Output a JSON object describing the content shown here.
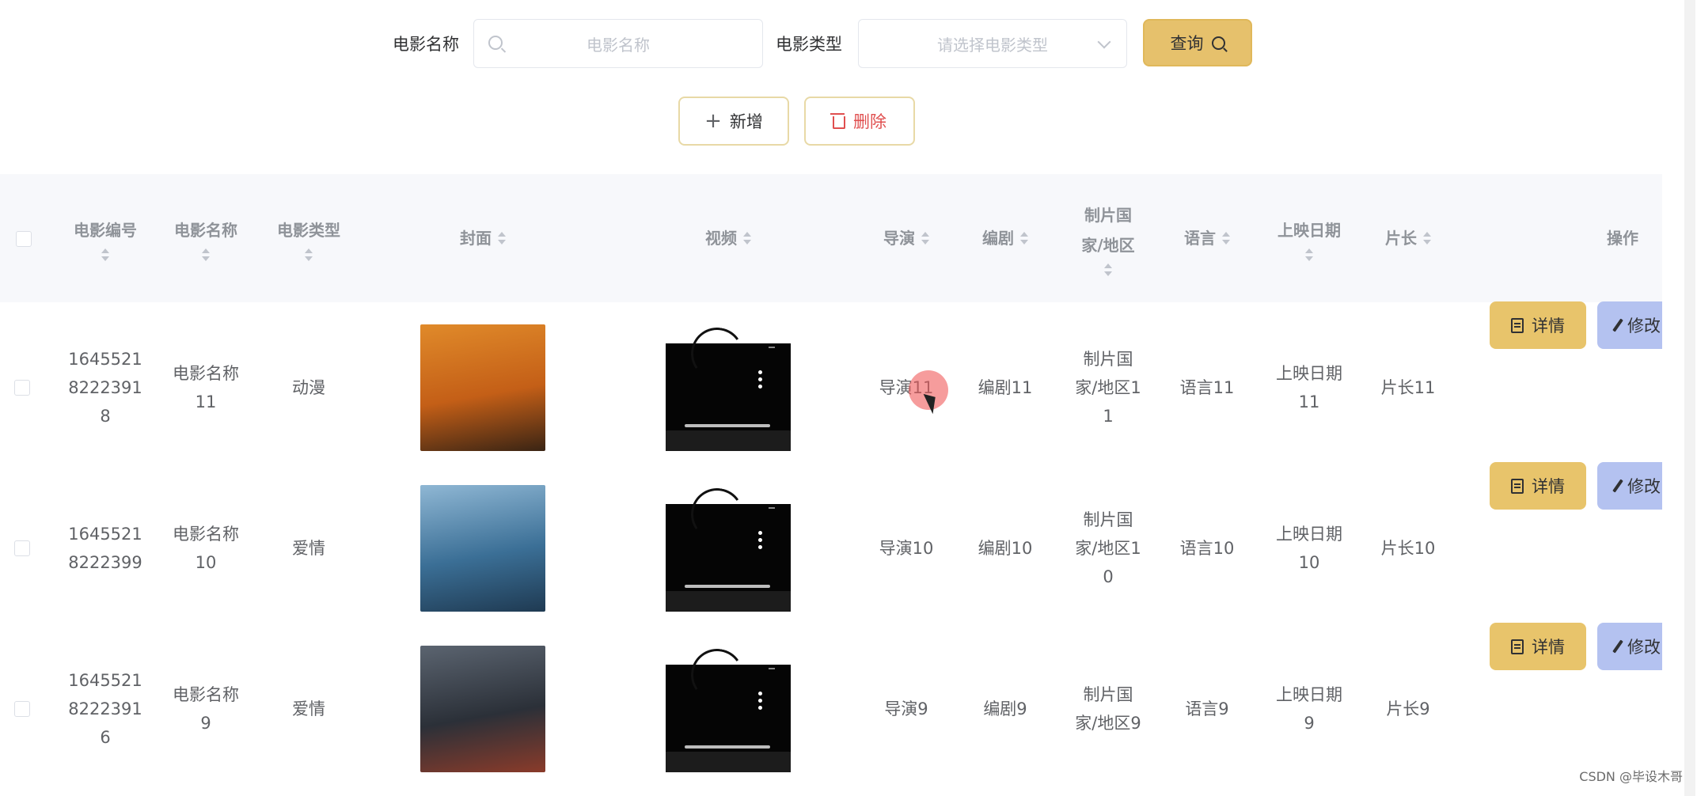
{
  "search": {
    "name_label": "电影名称",
    "name_placeholder": "电影名称",
    "type_label": "电影类型",
    "type_placeholder": "请选择电影类型",
    "query_label": "查询"
  },
  "actions": {
    "add_label": "新增",
    "delete_label": "删除"
  },
  "table": {
    "headers": {
      "id": "电影编号",
      "name": "电影名称",
      "type": "电影类型",
      "cover": "封面",
      "video": "视频",
      "director": "导演",
      "writer": "编剧",
      "country_line1": "制片国",
      "country_line2": "家/地区",
      "language": "语言",
      "release": "上映日期",
      "duration": "片长",
      "ops": "操作"
    },
    "rows": [
      {
        "id_lines": [
          "1645521",
          "8222391",
          "8"
        ],
        "name_lines": [
          "电影名称",
          "11"
        ],
        "type": "动漫",
        "director": "导演11",
        "writer": "编剧11",
        "country_lines": [
          "制片国",
          "家/地区1",
          "1"
        ],
        "language": "语言11",
        "release_lines": [
          "上映日期",
          "11"
        ],
        "duration": "片长11",
        "cover_colors": [
          "#e08a2a",
          "#c45f17",
          "#3a2414"
        ],
        "detail_label": "详情",
        "edit_label": "修改"
      },
      {
        "id_lines": [
          "1645521",
          "8222399"
        ],
        "name_lines": [
          "电影名称",
          "10"
        ],
        "type": "爱情",
        "director": "导演10",
        "writer": "编剧10",
        "country_lines": [
          "制片国",
          "家/地区1",
          "0"
        ],
        "language": "语言10",
        "release_lines": [
          "上映日期",
          "10"
        ],
        "duration": "片长10",
        "cover_colors": [
          "#8fb7d4",
          "#3b6f96",
          "#1f3a52"
        ],
        "detail_label": "详情",
        "edit_label": "修改"
      },
      {
        "id_lines": [
          "1645521",
          "8222391",
          "6"
        ],
        "name_lines": [
          "电影名称",
          "9"
        ],
        "type": "爱情",
        "director": "导演9",
        "writer": "编剧9",
        "country_lines": [
          "制片国",
          "家/地区9"
        ],
        "language": "语言9",
        "release_lines": [
          "上映日期",
          "9"
        ],
        "duration": "片长9",
        "cover_colors": [
          "#5b6470",
          "#2b3038",
          "#8a3b2a"
        ],
        "detail_label": "详情",
        "edit_label": "修改"
      }
    ]
  },
  "watermark": "CSDN @毕设木哥"
}
